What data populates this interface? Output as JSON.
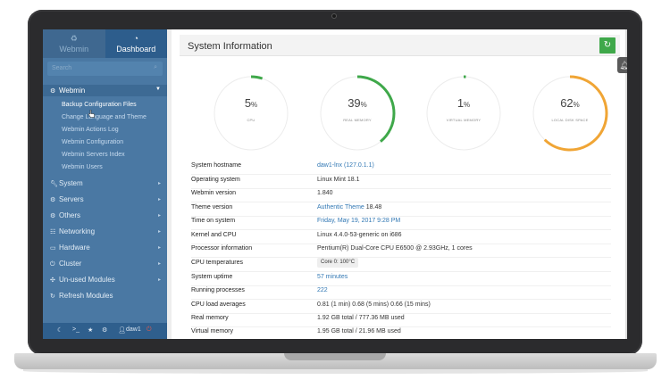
{
  "sidebar": {
    "tabs": [
      {
        "label": "Webmin",
        "icon": "recycle-icon"
      },
      {
        "label": "Dashboard",
        "icon": "dashboard-icon"
      }
    ],
    "search_placeholder": "Search",
    "active_group": "Webmin",
    "webmin_items": [
      "Backup Configuration Files",
      "Change Language and Theme",
      "Webmin Actions Log",
      "Webmin Configuration",
      "Webmin Servers Index",
      "Webmin Users"
    ],
    "groups": [
      {
        "label": "System",
        "icon": "wrench-icon"
      },
      {
        "label": "Servers",
        "icon": "cog-icon"
      },
      {
        "label": "Others",
        "icon": "cogs-icon"
      },
      {
        "label": "Networking",
        "icon": "network-icon"
      },
      {
        "label": "Hardware",
        "icon": "harddrive-icon"
      },
      {
        "label": "Cluster",
        "icon": "power-icon"
      },
      {
        "label": "Un-used Modules",
        "icon": "puzzle-icon"
      },
      {
        "label": "Refresh Modules",
        "icon": "refresh-icon"
      }
    ],
    "footer_user": "daw1",
    "footer_terminal": ">_"
  },
  "panel": {
    "title": "System Information",
    "colors": {
      "green": "#3fa84a",
      "orange": "#f0a535",
      "track": "#ececec"
    }
  },
  "gauges": [
    {
      "value": "5",
      "unit": "%",
      "label": "CPU",
      "fraction": 0.05,
      "color": "#3fa84a"
    },
    {
      "value": "39",
      "unit": "%",
      "label": "REAL MEMORY",
      "fraction": 0.39,
      "color": "#3fa84a"
    },
    {
      "value": "1",
      "unit": "%",
      "label": "VIRTUAL MEMORY",
      "fraction": 0.01,
      "color": "#3fa84a"
    },
    {
      "value": "62",
      "unit": "%",
      "label": "LOCAL DISK SPACE",
      "fraction": 0.62,
      "color": "#f0a535"
    }
  ],
  "info": {
    "hostname": {
      "key": "System hostname",
      "value": "daw1-lnx (127.0.1.1)"
    },
    "os": {
      "key": "Operating system",
      "value": "Linux Mint 18.1"
    },
    "webmin_version": {
      "key": "Webmin version",
      "value": "1.840"
    },
    "theme_version": {
      "key": "Theme version",
      "link": "Authentic Theme",
      "value": "18.48"
    },
    "time": {
      "key": "Time on system",
      "value": "Friday, May 19, 2017 9:28 PM"
    },
    "kernel": {
      "key": "Kernel and CPU",
      "value": "Linux 4.4.0-53-generic on i686"
    },
    "processor": {
      "key": "Processor information",
      "value": "Pentium(R) Dual-Core CPU E6500 @ 2.93GHz, 1 cores"
    },
    "cpu_temp": {
      "key": "CPU temperatures",
      "value": "Core 0: 100°C"
    },
    "uptime": {
      "key": "System uptime",
      "value": "57 minutes"
    },
    "processes": {
      "key": "Running processes",
      "value": "222"
    },
    "load": {
      "key": "CPU load averages",
      "value": "0.81 (1 min) 0.68 (5 mins) 0.66 (15 mins)"
    },
    "real_memory": {
      "key": "Real memory",
      "value": "1.92 GB total / 777.36 MB used"
    },
    "virtual_memory": {
      "key": "Virtual memory",
      "value": "1.95 GB total / 21.96 MB used"
    }
  }
}
